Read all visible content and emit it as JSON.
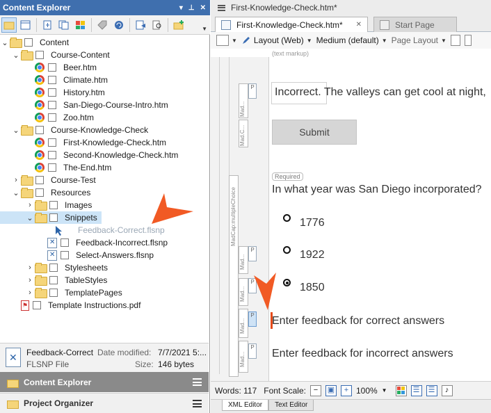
{
  "left_pane": {
    "title": "Content Explorer",
    "header_controls": [
      "▾",
      "⊥",
      "✕"
    ],
    "tree": [
      {
        "label": "Content",
        "kind": "folder",
        "expanded": true,
        "level": 0
      },
      {
        "label": "Course-Content",
        "kind": "folder",
        "expanded": true,
        "level": 1
      },
      {
        "label": "Beer.htm",
        "kind": "chrome",
        "level": 2
      },
      {
        "label": "Climate.htm",
        "kind": "chrome",
        "level": 2
      },
      {
        "label": "History.htm",
        "kind": "chrome",
        "level": 2
      },
      {
        "label": "San-Diego-Course-Intro.htm",
        "kind": "chrome",
        "level": 2
      },
      {
        "label": "Zoo.htm",
        "kind": "chrome",
        "level": 2
      },
      {
        "label": "Course-Knowledge-Check",
        "kind": "folder",
        "expanded": true,
        "level": 1
      },
      {
        "label": "First-Knowledge-Check.htm",
        "kind": "chrome",
        "level": 2
      },
      {
        "label": "Second-Knowledge-Check.htm",
        "kind": "chrome",
        "level": 2
      },
      {
        "label": "The-End.htm",
        "kind": "chrome",
        "level": 2
      },
      {
        "label": "Course-Test",
        "kind": "folder",
        "expanded": false,
        "level": 1
      },
      {
        "label": "Resources",
        "kind": "folder",
        "expanded": true,
        "level": 1
      },
      {
        "label": "Images",
        "kind": "folder",
        "expanded": false,
        "level": 2
      },
      {
        "label": "Snippets",
        "kind": "folder",
        "expanded": true,
        "level": 2,
        "selected": true
      },
      {
        "label": "Feedback-Correct.flsnp",
        "kind": "ghost",
        "level": 3
      },
      {
        "label": "Feedback-Incorrect.flsnp",
        "kind": "snippet",
        "level": 3
      },
      {
        "label": "Select-Answers.flsnp",
        "kind": "snippet",
        "level": 3
      },
      {
        "label": "Stylesheets",
        "kind": "folder",
        "expanded": false,
        "level": 2
      },
      {
        "label": "TableStyles",
        "kind": "folder",
        "expanded": false,
        "level": 2
      },
      {
        "label": "TemplatePages",
        "kind": "folder",
        "expanded": false,
        "level": 2
      },
      {
        "label": "Template Instructions.pdf",
        "kind": "pdf",
        "level": 1
      }
    ],
    "details": {
      "name": "Feedback-Correct",
      "type": "FLSNP File",
      "date_label": "Date modified:",
      "date_value": "7/7/2021 5:...",
      "size_label": "Size:",
      "size_value": "146 bytes"
    },
    "accordion": [
      "Content Explorer",
      "Project Organizer"
    ]
  },
  "right_pane": {
    "title": "First-Knowledge-Check.htm*",
    "tabs": [
      {
        "label": "First-Knowledge-Check.htm*",
        "active": true
      },
      {
        "label": "Start Page",
        "active": false
      }
    ],
    "toolbar": {
      "layout": "Layout (Web)",
      "medium": "Medium (default)",
      "page_layout": "Page Layout"
    },
    "text_markup": "(text markup)",
    "structure_labels": [
      "Mad...",
      "Mad.C...",
      "MadCap:multipleChoice",
      "Mad...",
      "Mad...",
      "Mad...",
      "Mad...",
      "Mad..."
    ],
    "content": {
      "incorrect_text": "Incorrect. The valleys can get cool at night,",
      "submit_label": "Submit",
      "required_label": "Required",
      "question": "In what year was San Diego incorporated?",
      "options": [
        {
          "label": "1776",
          "checked": false
        },
        {
          "label": "1922",
          "checked": false
        },
        {
          "label": "1850",
          "checked": true
        }
      ],
      "feedback_correct": "Enter feedback for correct answers",
      "feedback_incorrect": "Enter feedback for incorrect answers"
    },
    "status": {
      "words": "Words: 117",
      "font_scale": "Font Scale:",
      "zoom": "100%"
    },
    "bottom_tabs": [
      "XML Editor",
      "Text Editor"
    ]
  },
  "colors": {
    "header_blue": "#3f6fae",
    "selection": "#cce4f7",
    "callout": "#f15a24"
  }
}
